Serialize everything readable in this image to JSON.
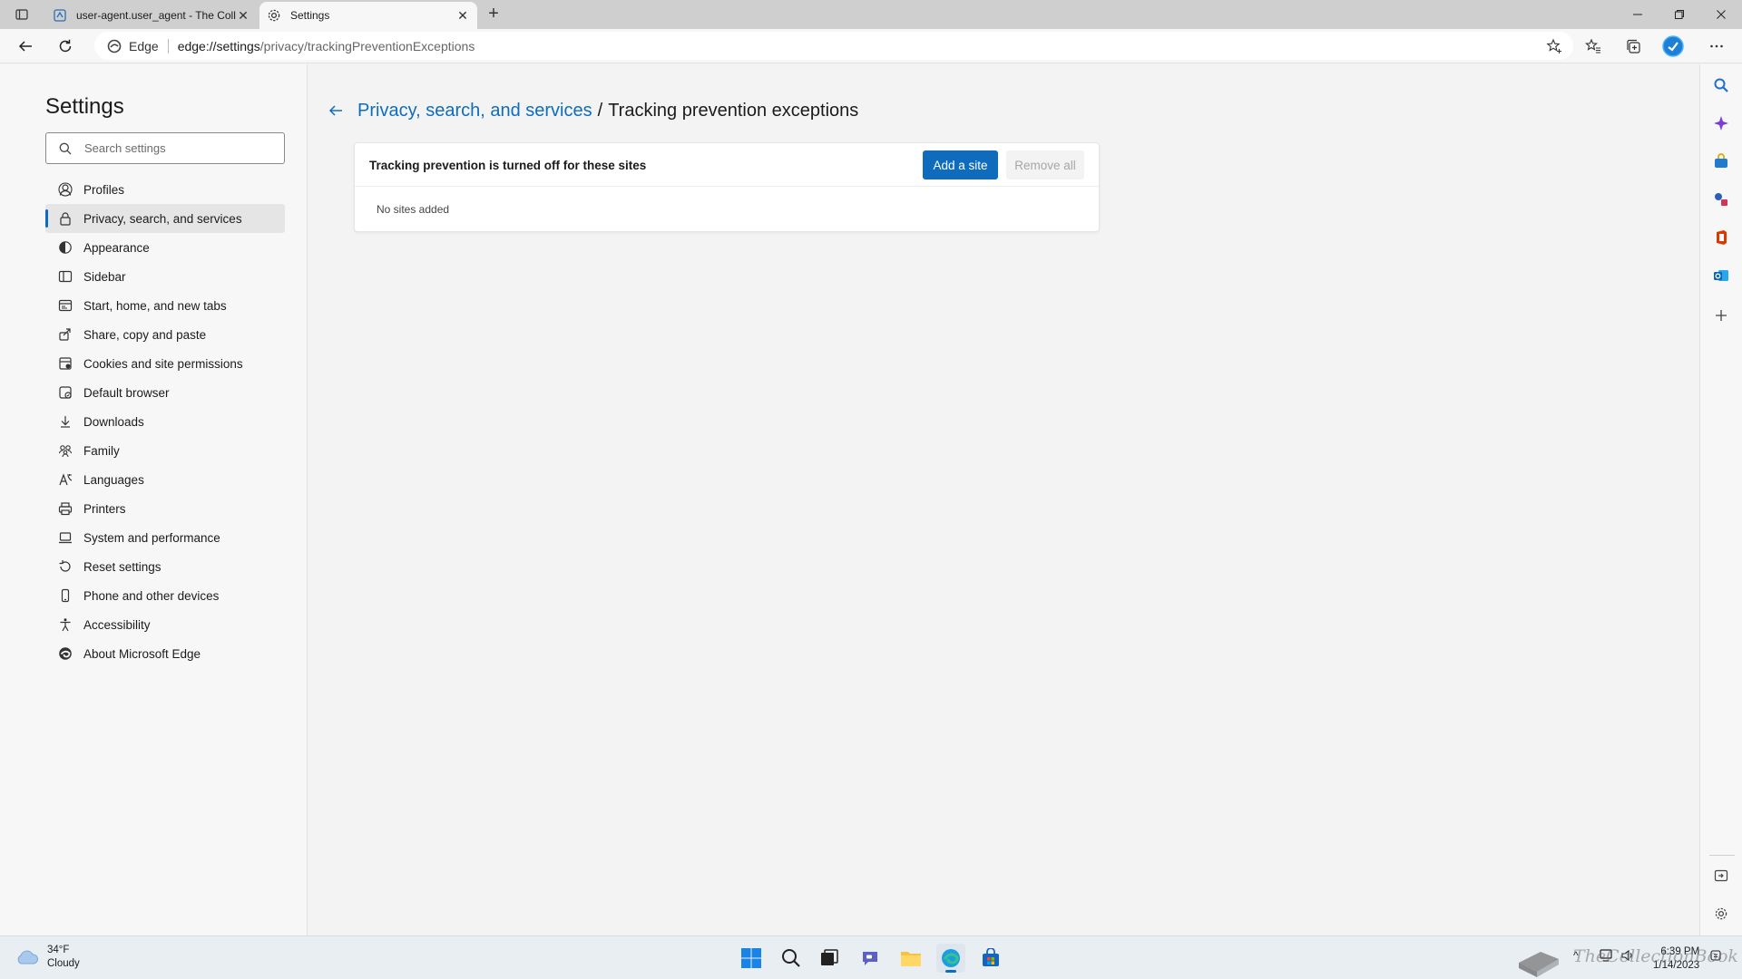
{
  "tabs": [
    {
      "title": "user-agent.user_agent - The Coll",
      "favicon": "page-icon"
    },
    {
      "title": "Settings",
      "favicon": "gear-icon"
    }
  ],
  "toolbar": {
    "site_label": "Edge",
    "url_host": "edge://settings",
    "url_path": "/privacy/trackingPreventionExceptions"
  },
  "sidebar": {
    "title": "Settings",
    "search_placeholder": "Search settings",
    "items": [
      {
        "label": "Profiles",
        "icon": "profile-icon"
      },
      {
        "label": "Privacy, search, and services",
        "icon": "lock-icon",
        "selected": true
      },
      {
        "label": "Appearance",
        "icon": "appearance-icon"
      },
      {
        "label": "Sidebar",
        "icon": "sidebar-icon"
      },
      {
        "label": "Start, home, and new tabs",
        "icon": "start-icon"
      },
      {
        "label": "Share, copy and paste",
        "icon": "share-icon"
      },
      {
        "label": "Cookies and site permissions",
        "icon": "cookies-icon"
      },
      {
        "label": "Default browser",
        "icon": "browser-icon"
      },
      {
        "label": "Downloads",
        "icon": "download-icon"
      },
      {
        "label": "Family",
        "icon": "family-icon"
      },
      {
        "label": "Languages",
        "icon": "languages-icon"
      },
      {
        "label": "Printers",
        "icon": "printer-icon"
      },
      {
        "label": "System and performance",
        "icon": "laptop-icon"
      },
      {
        "label": "Reset settings",
        "icon": "reset-icon"
      },
      {
        "label": "Phone and other devices",
        "icon": "phone-icon"
      },
      {
        "label": "Accessibility",
        "icon": "accessibility-icon"
      },
      {
        "label": "About Microsoft Edge",
        "icon": "edge-icon"
      }
    ]
  },
  "main": {
    "breadcrumb_parent": "Privacy, search, and services",
    "breadcrumb_separator": "/",
    "breadcrumb_current": "Tracking prevention exceptions",
    "card_heading": "Tracking prevention is turned off for these sites",
    "add_button": "Add a site",
    "remove_button": "Remove all",
    "empty_text": "No sites added"
  },
  "taskbar": {
    "temperature": "34°F",
    "condition": "Cloudy",
    "time": "6:39 PM",
    "date": "1/14/2023"
  },
  "watermark": "TheCollectionBook",
  "colors": {
    "accent": "#0f6cbd",
    "background": "#f3f3f3"
  }
}
